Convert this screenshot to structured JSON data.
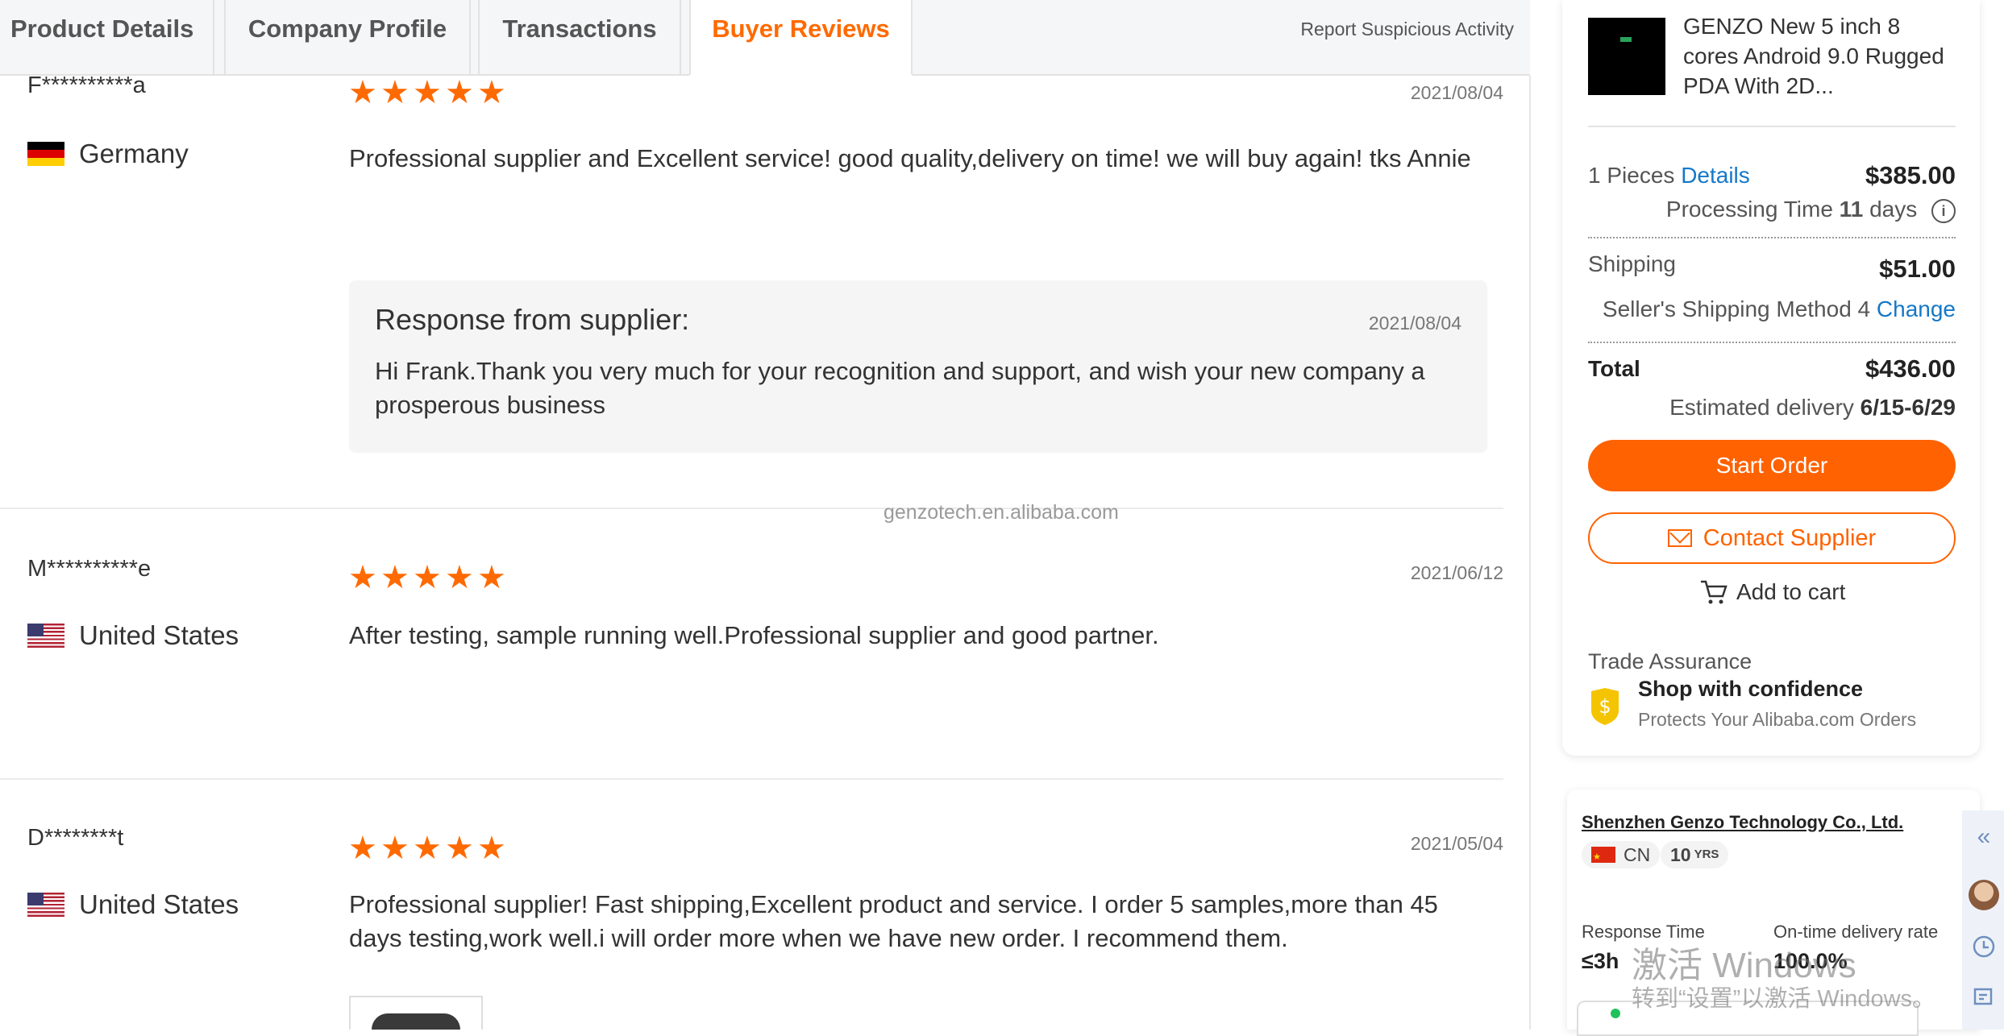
{
  "tabs": [
    {
      "label": "Product Details",
      "active": false
    },
    {
      "label": "Company Profile",
      "active": false
    },
    {
      "label": "Transactions",
      "active": false
    },
    {
      "label": "Buyer Reviews",
      "active": true
    }
  ],
  "report_link": "Report Suspicious Activity",
  "reviews": [
    {
      "buyer": "F**********a",
      "country": "Germany",
      "rating": 5,
      "date": "2021/08/04",
      "text": "Professional supplier and Excellent service! good quality,delivery on time! we will buy again! tks Annie",
      "response": {
        "title": "Response from supplier:",
        "date": "2021/08/04",
        "text": "Hi Frank.Thank you very much for your recognition and support, and wish your new company a prosperous business"
      }
    },
    {
      "buyer": "M**********e",
      "country": "United States",
      "rating": 5,
      "date": "2021/06/12",
      "text": "After testing, sample running well.Professional supplier and good partner."
    },
    {
      "buyer": "D********t",
      "country": "United States",
      "rating": 5,
      "date": "2021/05/04",
      "text": "Professional supplier! Fast shipping,Excellent product and service. I order 5 samples,more than 45 days testing,work well.i will order more when we have new order. I recommend them."
    }
  ],
  "watermark": "genzotech.en.alibaba.com",
  "order": {
    "product_title": "GENZO New 5 inch 8 cores Android 9.0 Rugged PDA With 2D...",
    "pieces_label": "1 Pieces",
    "details_link": "Details",
    "price": "$385.00",
    "processing_label": "Processing Time",
    "processing_days": "11",
    "processing_unit": "days",
    "shipping_label": "Shipping",
    "shipping_price": "$51.00",
    "shipping_method": "Seller's Shipping Method 4",
    "change_link": "Change",
    "total_label": "Total",
    "total_price": "$436.00",
    "delivery_label": "Estimated delivery",
    "delivery_range": "6/15-6/29",
    "start_order": "Start Order",
    "contact_supplier": "Contact Supplier",
    "add_to_cart": "Add to cart",
    "trade_assurance": "Trade Assurance",
    "shop_confidence": "Shop with confidence",
    "protects": "Protects Your Alibaba.com Orders"
  },
  "company": {
    "name": "Shenzhen Genzo Technology Co., Ltd.",
    "country_code": "CN",
    "years": "10",
    "years_unit": "YRS",
    "response_time_label": "Response Time",
    "response_time": "≤3h",
    "ontime_label": "On-time delivery rate",
    "ontime_value": "100.0%"
  },
  "windows_activation": {
    "line1": "激活 Windows",
    "line2": "转到“设置”以激活 Windows。"
  },
  "colors": {
    "accent": "#ff6a00",
    "link": "#1478c8",
    "star": "#ff6a00"
  }
}
